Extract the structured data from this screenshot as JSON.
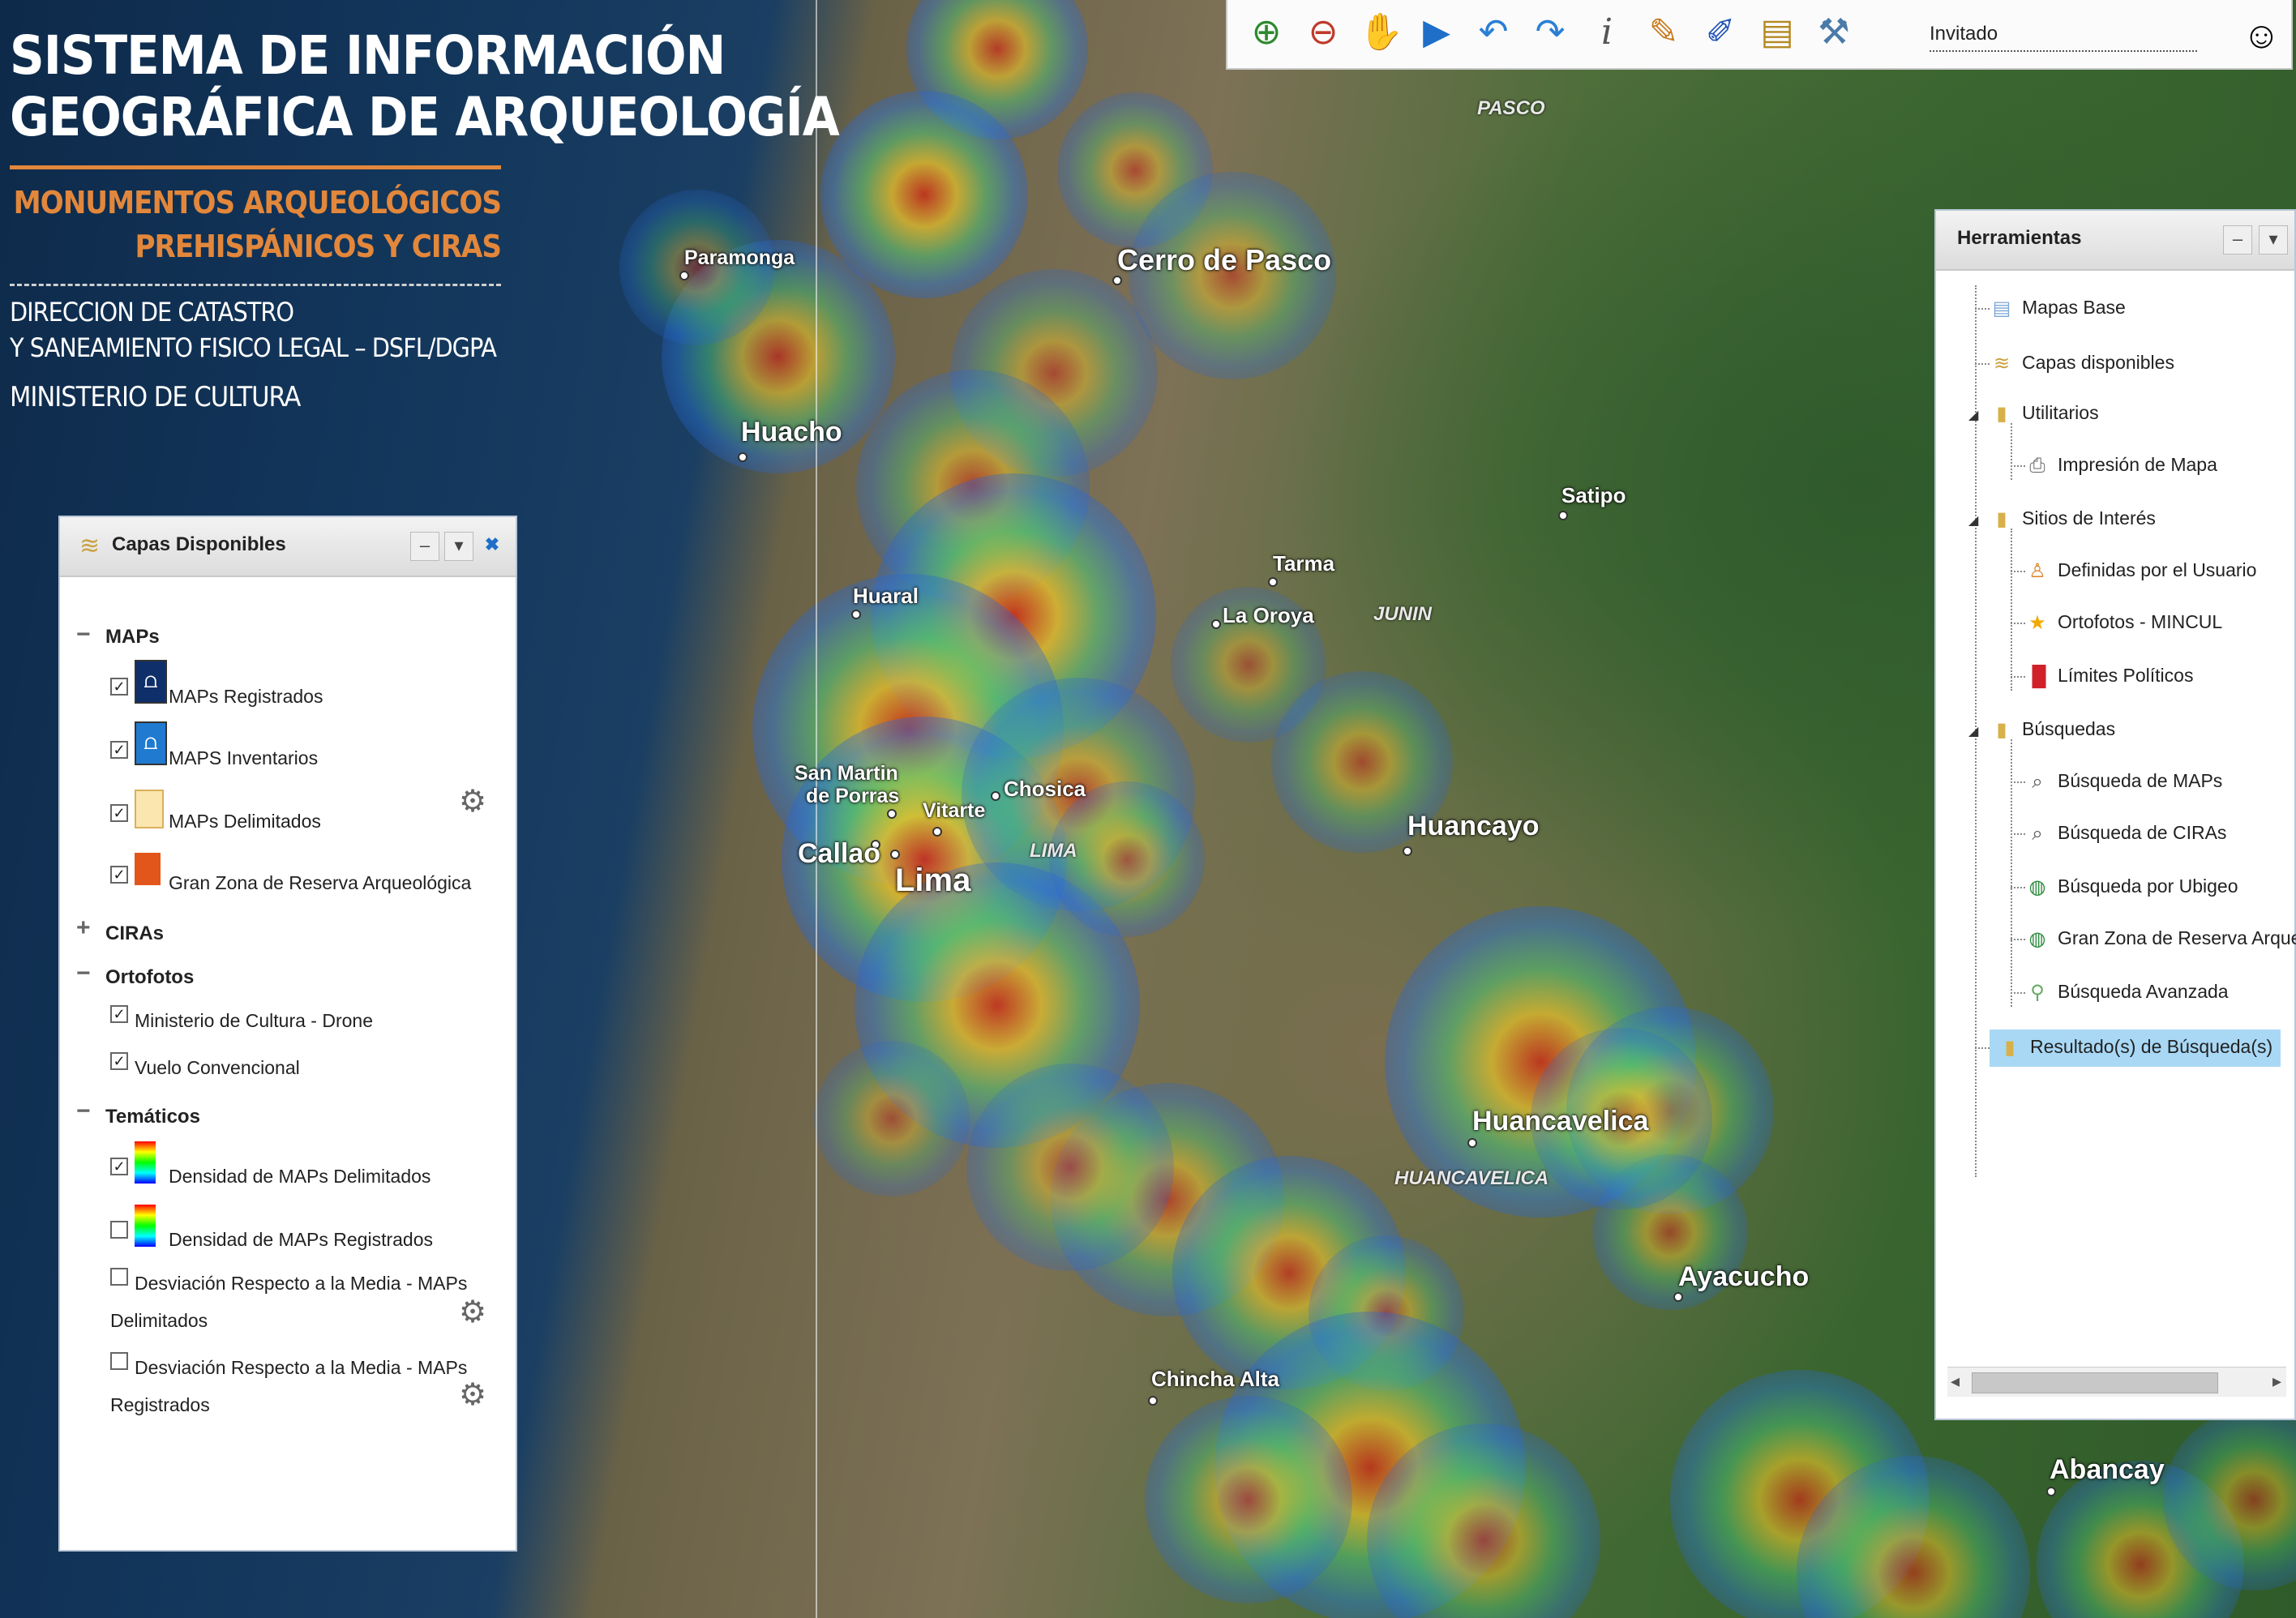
{
  "header": {
    "title_line1": "SISTEMA DE INFORMACIÓN",
    "title_line2": "GEOGRÁFICA DE ARQUEOLOGÍA",
    "subtitle_line1": "MONUMENTOS ARQUEOLÓGICOS",
    "subtitle_line2": "PREHISPÁNICOS Y CIRAS",
    "org_line1": "DIRECCION DE CATASTRO",
    "org_line2": "Y SANEAMIENTO FISICO LEGAL – DSFL/DGPA",
    "ministry": "MINISTERIO DE CULTURA",
    "accent_color": "#e2873b"
  },
  "toolbar": {
    "buttons": [
      "zoom-in-icon",
      "zoom-out-icon",
      "pan-hand-icon",
      "play-icon",
      "undo-icon",
      "redo-icon",
      "info-icon",
      "brush-icon",
      "measure-icon",
      "ruler-icon",
      "tools-icon"
    ],
    "user": "Invitado"
  },
  "map": {
    "cities": [
      "Paramonga",
      "Cerro de Pasco",
      "Huacho",
      "Satipo",
      "Huaral",
      "Tarma",
      "La Oroya",
      "San Martin",
      "de Porras",
      "Chosica",
      "Vitarte",
      "Callao",
      "Lima",
      "Huancayo",
      "Huancavelica",
      "Ayacucho",
      "Chincha Alta",
      "Abancay"
    ],
    "regions": [
      "PASCO",
      "JUNIN",
      "LIMA",
      "HUANCAVELICA"
    ]
  },
  "layers_panel": {
    "title": "Capas Disponibles",
    "sections": {
      "maps": "MAPs",
      "ciras": "CIRAs",
      "ortofotos": "Ortofotos",
      "tematicos": "Temáticos"
    },
    "items": {
      "maps_registrados": "MAPs Registrados",
      "maps_inventarios": "MAPS Inventarios",
      "maps_delimitados": "MAPs Delimitados",
      "gran_zona": "Gran Zona de Reserva Arqueológica",
      "drone": "Ministerio de Cultura - Drone",
      "vuelo": "Vuelo Convencional",
      "densidad_delimitados": "Densidad de MAPs Delimitados",
      "densidad_registrados": "Densidad de MAPs Registrados",
      "desviacion_delimitados_1": "Desviación Respecto a la Media - MAPs",
      "desviacion_delimitados_2": "Delimitados",
      "desviacion_registrados_1": "Desviación Respecto a la Media - MAPs",
      "desviacion_registrados_2": "Registrados"
    }
  },
  "tools_panel": {
    "title": "Herramientas",
    "items": {
      "mapas_base": "Mapas Base",
      "capas": "Capas disponibles",
      "utilitarios": "Utilitarios",
      "impresion": "Impresión de Mapa",
      "sitios": "Sitios de Interés",
      "definidas": "Definidas por el Usuario",
      "ortofotos": "Ortofotos - MINCUL",
      "limites": "Límites Políticos",
      "busquedas": "Búsquedas",
      "busq_maps": "Búsqueda de MAPs",
      "busq_ciras": "Búsqueda de CIRAs",
      "busq_ubigeo": "Búsqueda por Ubigeo",
      "busq_gran": "Gran Zona de Reserva Arque",
      "busq_avanzada": "Búsqueda Avanzada",
      "resultados": "Resultado(s) de Búsqueda(s)"
    }
  }
}
